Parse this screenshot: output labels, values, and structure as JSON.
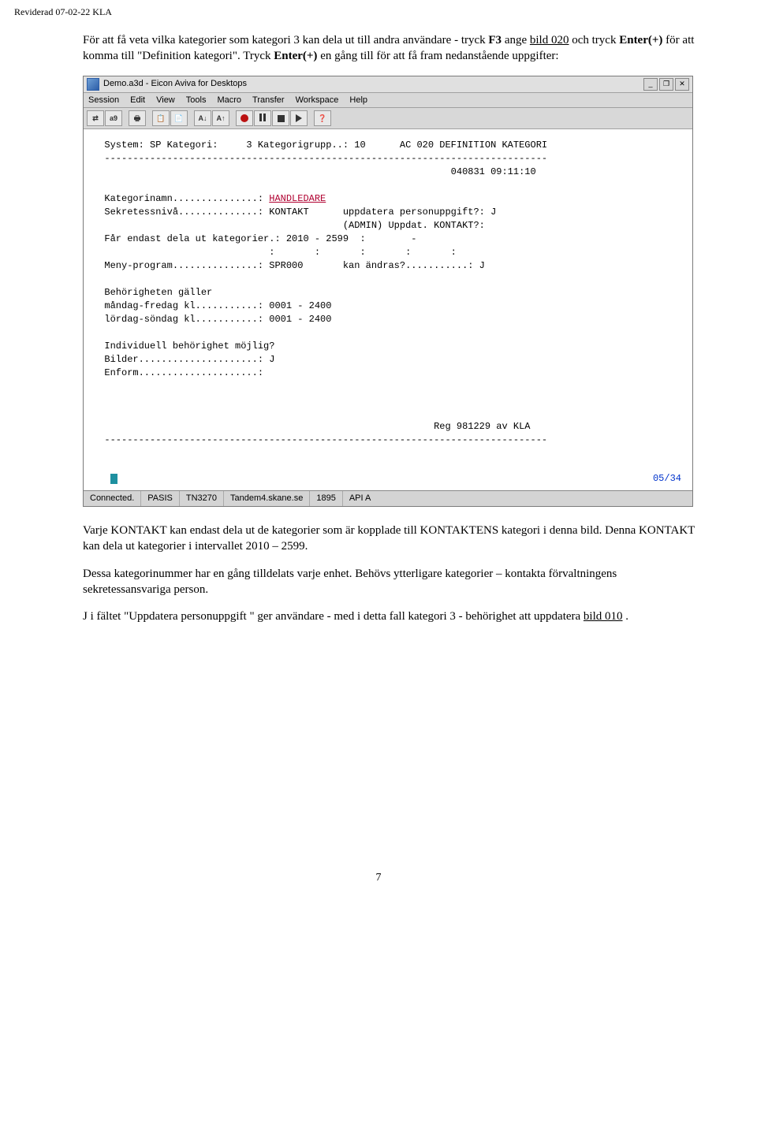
{
  "header": "Reviderad 07-02-22 KLA",
  "para1_pre": "För att få veta vilka kategorier som  kategori 3 kan dela ut till andra användare  - tryck ",
  "para1_f3": "F3",
  "para1_mid1": " ange ",
  "para1_bild": "bild 020",
  "para1_mid2": " och tryck ",
  "para1_enter": "Enter(+)",
  "para1_post": " för att komma till \"Definition kategori\". Tryck ",
  "para1_enter2": "Enter(+)",
  "para1_end": " en gång till för att få fram nedanstående uppgifter:",
  "app": {
    "title": "Demo.a3d - Eicon Aviva for Desktops",
    "menu": [
      "Session",
      "Edit",
      "View",
      "Tools",
      "Macro",
      "Transfer",
      "Workspace",
      "Help"
    ],
    "status": {
      "conn": "Connected.",
      "sys": "PASIS",
      "term": "TN3270",
      "host": "Tandem4.skane.se",
      "port": "1895",
      "api": "API A"
    }
  },
  "term": {
    "l1a": "  System: SP Kategori:     3 Kategorigrupp..: 10      AC 020 DEFINITION KATEGORI",
    "l1b": "  ------------------------------------------------------------------------------",
    "l1c": "                                                               040831 09:11:10",
    "l2a": "  Kategorinamn...............: ",
    "l2a_hl": "HANDLEDARE",
    "l2b": "  Sekretessnivå..............: KONTAKT      uppdatera personuppgift?: J",
    "l2c": "                                            (ADMIN) Uppdat. KONTAKT?:",
    "l2d": "  Får endast dela ut kategorier.: 2010 - 2599  :        -",
    "l2e": "                               :       :       :       :       :",
    "l2f": "  Meny-program...............: SPR000       kan ändras?...........: J",
    "l3a": "  Behörigheten gäller",
    "l3b": "  måndag-fredag kl...........: 0001 - 2400",
    "l3c": "  lördag-söndag kl...........: 0001 - 2400",
    "l4a": "  Individuell behörighet möjlig?",
    "l4b": "  Bilder.....................: J",
    "l4c": "  Enform.....................:",
    "l5": "                                                            Reg 981229 av KLA",
    "l6": "  ------------------------------------------------------------------------------",
    "pageind": "05/34"
  },
  "para2": "Varje KONTAKT kan endast dela ut de kategorier som är kopplade till KONTAKTENS kategori i denna bild. Denna KONTAKT kan dela ut kategorier i intervallet 2010 – 2599.",
  "para3": "Dessa kategorinummer  har en gång tilldelats varje enhet. Behövs ytterligare kategorier – kontakta förvaltningens sekretessansvariga person.",
  "para4_pre": "J i fältet \"Uppdatera personuppgift \" ger användare -  med i detta fall kategori  3 - behörighet  att uppdatera ",
  "para4_link": "bild 010",
  "para4_post": " .",
  "pagenum": "7"
}
